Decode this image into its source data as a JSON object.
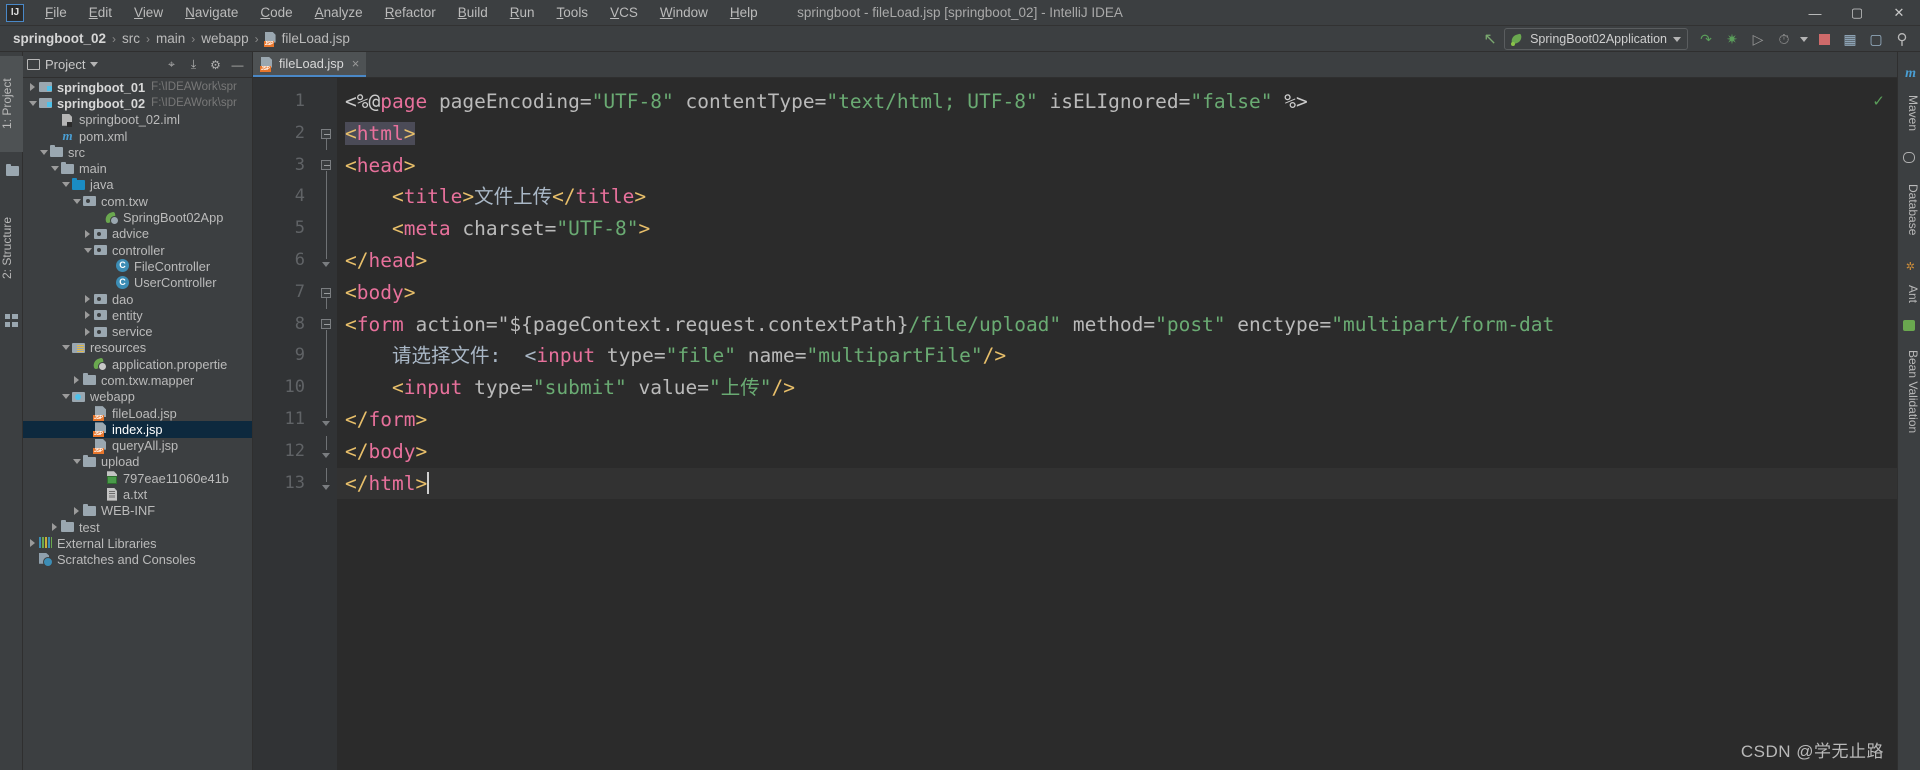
{
  "window": {
    "title": "springboot - fileLoad.jsp [springboot_02] - IntelliJ IDEA",
    "logo": "IJ",
    "minimize": "—",
    "maximize": "▢",
    "close": "✕"
  },
  "menu": [
    {
      "label": "File"
    },
    {
      "label": "Edit"
    },
    {
      "label": "View"
    },
    {
      "label": "Navigate"
    },
    {
      "label": "Code"
    },
    {
      "label": "Analyze"
    },
    {
      "label": "Refactor"
    },
    {
      "label": "Build"
    },
    {
      "label": "Run"
    },
    {
      "label": "Tools"
    },
    {
      "label": "VCS"
    },
    {
      "label": "Window"
    },
    {
      "label": "Help"
    }
  ],
  "breadcrumb": {
    "items": [
      "springboot_02",
      "src",
      "main",
      "webapp",
      "fileLoad.jsp"
    ],
    "separator": "›"
  },
  "toolbar": {
    "run_config": "SpringBoot02Application",
    "buttons": [
      {
        "name": "build-hammer",
        "glyph": "↖"
      },
      {
        "name": "run",
        "glyph": "▶"
      },
      {
        "name": "debug",
        "glyph": "✱"
      },
      {
        "name": "run-coverage",
        "glyph": "⏵"
      },
      {
        "name": "profiler",
        "glyph": "◴"
      },
      {
        "name": "stop",
        "glyph": "■"
      },
      {
        "name": "project-structure",
        "glyph": "▤"
      },
      {
        "name": "update-app",
        "glyph": "▷"
      },
      {
        "name": "search-everywhere",
        "glyph": "⚲"
      }
    ]
  },
  "left_strip": {
    "tabs": [
      {
        "label": "1: Project",
        "active": true
      },
      {
        "label": "2: Structure",
        "active": false
      }
    ]
  },
  "right_strip": {
    "tabs": [
      {
        "label": "Maven"
      },
      {
        "label": "Database"
      },
      {
        "label": "Ant"
      },
      {
        "label": "Bean Validation"
      }
    ]
  },
  "project_panel": {
    "title": "Project",
    "header_buttons": [
      {
        "name": "locate-target",
        "glyph": "⌖"
      },
      {
        "name": "collapse-all",
        "glyph": "⤓"
      },
      {
        "name": "settings-gear",
        "glyph": "⚙"
      },
      {
        "name": "hide-panel",
        "glyph": "—"
      }
    ],
    "tree": [
      {
        "indent": 0,
        "arrow": "r",
        "icon": "ic-module",
        "label": "springboot_01",
        "bold": true,
        "path": "F:\\IDEAWork\\spr",
        "selected": false
      },
      {
        "indent": 0,
        "arrow": "d",
        "icon": "ic-module",
        "label": "springboot_02",
        "bold": true,
        "path": "F:\\IDEAWork\\spr",
        "selected": false
      },
      {
        "indent": 2,
        "arrow": "none",
        "icon": "ic-iml",
        "label": "springboot_02.iml",
        "bold": false,
        "path": "",
        "selected": false
      },
      {
        "indent": 2,
        "arrow": "none",
        "icon": "ic-mvn",
        "label": "pom.xml",
        "bold": false,
        "path": "",
        "selected": false
      },
      {
        "indent": 1,
        "arrow": "d",
        "icon": "ic-folder",
        "label": "src",
        "bold": false,
        "path": "",
        "selected": false
      },
      {
        "indent": 2,
        "arrow": "d",
        "icon": "ic-folder",
        "label": "main",
        "bold": false,
        "path": "",
        "selected": false
      },
      {
        "indent": 3,
        "arrow": "d",
        "icon": "ic-src",
        "label": "java",
        "bold": false,
        "path": "",
        "selected": false
      },
      {
        "indent": 4,
        "arrow": "d",
        "icon": "ic-pkg",
        "label": "com.txw",
        "bold": false,
        "path": "",
        "selected": false
      },
      {
        "indent": 6,
        "arrow": "none",
        "icon": "ic-spring",
        "label": "SpringBoot02App",
        "bold": false,
        "path": "",
        "selected": false
      },
      {
        "indent": 5,
        "arrow": "r",
        "icon": "ic-pkg",
        "label": "advice",
        "bold": false,
        "path": "",
        "selected": false
      },
      {
        "indent": 5,
        "arrow": "d",
        "icon": "ic-pkg",
        "label": "controller",
        "bold": false,
        "path": "",
        "selected": false
      },
      {
        "indent": 7,
        "arrow": "none",
        "icon": "ic-class",
        "label": "FileController",
        "bold": false,
        "path": "",
        "selected": false
      },
      {
        "indent": 7,
        "arrow": "none",
        "icon": "ic-class",
        "label": "UserController",
        "bold": false,
        "path": "",
        "selected": false
      },
      {
        "indent": 5,
        "arrow": "r",
        "icon": "ic-pkg",
        "label": "dao",
        "bold": false,
        "path": "",
        "selected": false
      },
      {
        "indent": 5,
        "arrow": "r",
        "icon": "ic-pkg",
        "label": "entity",
        "bold": false,
        "path": "",
        "selected": false
      },
      {
        "indent": 5,
        "arrow": "r",
        "icon": "ic-pkg",
        "label": "service",
        "bold": false,
        "path": "",
        "selected": false
      },
      {
        "indent": 3,
        "arrow": "d",
        "icon": "ic-res",
        "label": "resources",
        "bold": false,
        "path": "",
        "selected": false
      },
      {
        "indent": 5,
        "arrow": "none",
        "icon": "ic-props",
        "label": "application.propertie",
        "bold": false,
        "path": "",
        "selected": false
      },
      {
        "indent": 4,
        "arrow": "r",
        "icon": "ic-folder",
        "label": "com.txw.mapper",
        "bold": false,
        "path": "",
        "selected": false
      },
      {
        "indent": 3,
        "arrow": "d",
        "icon": "ic-web",
        "label": "webapp",
        "bold": false,
        "path": "",
        "selected": false
      },
      {
        "indent": 5,
        "arrow": "none",
        "icon": "ic-jsp",
        "label": "fileLoad.jsp",
        "bold": false,
        "path": "",
        "selected": false
      },
      {
        "indent": 5,
        "arrow": "none",
        "icon": "ic-jsp",
        "label": "index.jsp",
        "bold": false,
        "path": "",
        "selected": true
      },
      {
        "indent": 5,
        "arrow": "none",
        "icon": "ic-jsp",
        "label": "queryAll.jsp",
        "bold": false,
        "path": "",
        "selected": false
      },
      {
        "indent": 4,
        "arrow": "d",
        "icon": "ic-folder",
        "label": "upload",
        "bold": false,
        "path": "",
        "selected": false
      },
      {
        "indent": 6,
        "arrow": "none",
        "icon": "ic-img",
        "label": "797eae11060e41b",
        "bold": false,
        "path": "",
        "selected": false
      },
      {
        "indent": 6,
        "arrow": "none",
        "icon": "ic-txt",
        "label": "a.txt",
        "bold": false,
        "path": "",
        "selected": false
      },
      {
        "indent": 4,
        "arrow": "r",
        "icon": "ic-folder",
        "label": "WEB-INF",
        "bold": false,
        "path": "",
        "selected": false
      },
      {
        "indent": 2,
        "arrow": "r",
        "icon": "ic-folder",
        "label": "test",
        "bold": false,
        "path": "",
        "selected": false
      },
      {
        "indent": 0,
        "arrow": "r",
        "icon": "ic-lib",
        "label": "External Libraries",
        "bold": false,
        "path": "",
        "selected": false
      },
      {
        "indent": 0,
        "arrow": "none",
        "icon": "ic-scr",
        "label": "Scratches and Consoles",
        "bold": false,
        "path": "",
        "selected": false
      }
    ]
  },
  "editor": {
    "tab": {
      "label": "fileLoad.jsp",
      "close": "×"
    },
    "inspection_status": "✓",
    "current_line": 13,
    "line_numbers": [
      1,
      2,
      3,
      4,
      5,
      6,
      7,
      8,
      9,
      10,
      11,
      12,
      13
    ],
    "lines": [
      {
        "n": 1,
        "fold": "none",
        "tokens": [
          {
            "t": "<%@",
            "c": "hl-punc"
          },
          {
            "t": "page",
            "c": "hl-tag"
          },
          {
            "t": " pageEncoding=",
            "c": "hl-attr"
          },
          {
            "t": "\"UTF-8\"",
            "c": "hl-str"
          },
          {
            "t": " contentType=",
            "c": "hl-attr"
          },
          {
            "t": "\"text/html; UTF-8\"",
            "c": "hl-str"
          },
          {
            "t": " isELIgnored=",
            "c": "hl-attr"
          },
          {
            "t": "\"false\"",
            "c": "hl-str"
          },
          {
            "t": " %>",
            "c": "hl-punc"
          }
        ]
      },
      {
        "n": 2,
        "fold": "start",
        "tokens": [
          {
            "t": "<",
            "c": "hl-brk tag-hl"
          },
          {
            "t": "html",
            "c": "hl-tag tag-hl"
          },
          {
            "t": ">",
            "c": "hl-brk tag-hl"
          }
        ]
      },
      {
        "n": 3,
        "fold": "start",
        "tokens": [
          {
            "t": "<",
            "c": "hl-brk"
          },
          {
            "t": "head",
            "c": "hl-tag"
          },
          {
            "t": ">",
            "c": "hl-brk"
          }
        ]
      },
      {
        "n": 4,
        "fold": "mid",
        "tokens": [
          {
            "t": "    <",
            "c": "hl-brk"
          },
          {
            "t": "title",
            "c": "hl-tag"
          },
          {
            "t": ">",
            "c": "hl-brk"
          },
          {
            "t": "文件上传",
            "c": "hl-txt"
          },
          {
            "t": "</",
            "c": "hl-brk"
          },
          {
            "t": "title",
            "c": "hl-tag"
          },
          {
            "t": ">",
            "c": "hl-brk"
          }
        ]
      },
      {
        "n": 5,
        "fold": "mid",
        "tokens": [
          {
            "t": "    <",
            "c": "hl-brk"
          },
          {
            "t": "meta",
            "c": "hl-tag"
          },
          {
            "t": " charset=",
            "c": "hl-attr"
          },
          {
            "t": "\"UTF-8\"",
            "c": "hl-str"
          },
          {
            "t": ">",
            "c": "hl-brk"
          }
        ]
      },
      {
        "n": 6,
        "fold": "end",
        "tokens": [
          {
            "t": "</",
            "c": "hl-brk"
          },
          {
            "t": "head",
            "c": "hl-tag"
          },
          {
            "t": ">",
            "c": "hl-brk"
          }
        ]
      },
      {
        "n": 7,
        "fold": "start",
        "tokens": [
          {
            "t": "<",
            "c": "hl-brk"
          },
          {
            "t": "body",
            "c": "hl-tag"
          },
          {
            "t": ">",
            "c": "hl-brk"
          }
        ]
      },
      {
        "n": 8,
        "fold": "start",
        "tokens": [
          {
            "t": "<",
            "c": "hl-brk"
          },
          {
            "t": "form",
            "c": "hl-tag"
          },
          {
            "t": " action=",
            "c": "hl-attr"
          },
          {
            "t": "\"${pageContext.request.contextPath}",
            "c": "hl-attr"
          },
          {
            "t": "/file/upload\"",
            "c": "hl-str"
          },
          {
            "t": " method=",
            "c": "hl-attr"
          },
          {
            "t": "\"post\"",
            "c": "hl-str"
          },
          {
            "t": " enctype=",
            "c": "hl-attr"
          },
          {
            "t": "\"multipart/form-dat",
            "c": "hl-str"
          }
        ]
      },
      {
        "n": 9,
        "fold": "mid",
        "tokens": [
          {
            "t": "    请选择文件:  <",
            "c": "hl-txt"
          },
          {
            "t": "input",
            "c": "hl-tag"
          },
          {
            "t": " type=",
            "c": "hl-attr"
          },
          {
            "t": "\"file\"",
            "c": "hl-str"
          },
          {
            "t": " name=",
            "c": "hl-attr"
          },
          {
            "t": "\"multipartFile\"",
            "c": "hl-str"
          },
          {
            "t": "/>",
            "c": "hl-brk"
          }
        ]
      },
      {
        "n": 10,
        "fold": "mid",
        "tokens": [
          {
            "t": "    <",
            "c": "hl-brk"
          },
          {
            "t": "input",
            "c": "hl-tag"
          },
          {
            "t": " type=",
            "c": "hl-attr"
          },
          {
            "t": "\"submit\"",
            "c": "hl-str"
          },
          {
            "t": " value=",
            "c": "hl-attr"
          },
          {
            "t": "\"上传\"",
            "c": "hl-str"
          },
          {
            "t": "/>",
            "c": "hl-brk"
          }
        ]
      },
      {
        "n": 11,
        "fold": "end",
        "tokens": [
          {
            "t": "</",
            "c": "hl-brk"
          },
          {
            "t": "form",
            "c": "hl-tag"
          },
          {
            "t": ">",
            "c": "hl-brk"
          }
        ]
      },
      {
        "n": 12,
        "fold": "end",
        "tokens": [
          {
            "t": "</",
            "c": "hl-brk"
          },
          {
            "t": "body",
            "c": "hl-tag"
          },
          {
            "t": ">",
            "c": "hl-brk"
          }
        ]
      },
      {
        "n": 13,
        "fold": "end",
        "tokens": [
          {
            "t": "</",
            "c": "hl-brk"
          },
          {
            "t": "html",
            "c": "hl-tag"
          },
          {
            "t": ">",
            "c": "hl-brk"
          }
        ]
      }
    ]
  },
  "watermark": "CSDN @学无止路",
  "colors": {
    "accent": "#4a88c7",
    "selection": "#0d293e",
    "editor_bg": "#2b2b2b",
    "panel_bg": "#3c3f41",
    "string": "#6aab73",
    "tag": "#e8719c",
    "bracket": "#e8bf6a"
  }
}
